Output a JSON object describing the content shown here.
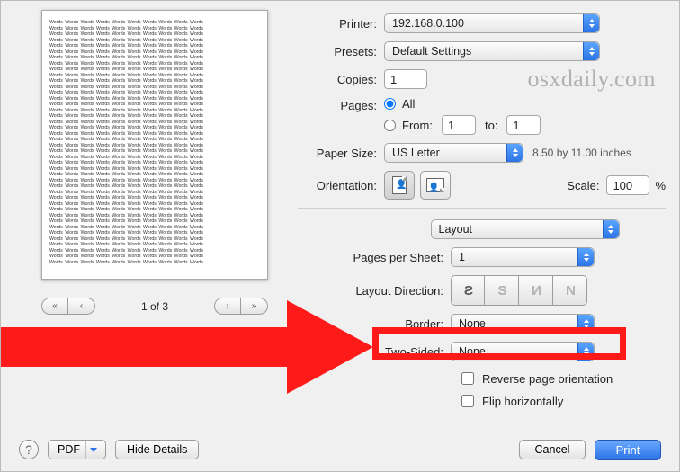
{
  "preview": {
    "sample_word": "Words",
    "pager": "1 of 3"
  },
  "settings": {
    "printer_label": "Printer:",
    "printer_value": "192.168.0.100",
    "presets_label": "Presets:",
    "presets_value": "Default Settings",
    "copies_label": "Copies:",
    "copies_value": "1",
    "pages_label": "Pages:",
    "pages_all": "All",
    "pages_from": "From:",
    "pages_from_value": "1",
    "pages_to": "to:",
    "pages_to_value": "1",
    "papersize_label": "Paper Size:",
    "papersize_value": "US Letter",
    "papersize_dim": "8.50 by 11.00 inches",
    "orientation_label": "Orientation:",
    "scale_label": "Scale:",
    "scale_value": "100",
    "scale_pct": "%",
    "pane": "Layout",
    "pps_label": "Pages per Sheet:",
    "pps_value": "1",
    "layoutdir_label": "Layout Direction:",
    "border_label": "Border:",
    "border_value": "None",
    "twosided_label": "Two-Sided:",
    "twosided_value": "None",
    "reverse": "Reverse page orientation",
    "fliph": "Flip horizontally"
  },
  "bottom": {
    "pdf": "PDF",
    "hide": "Hide Details",
    "cancel": "Cancel",
    "print": "Print"
  },
  "watermark": "osxdaily.com"
}
